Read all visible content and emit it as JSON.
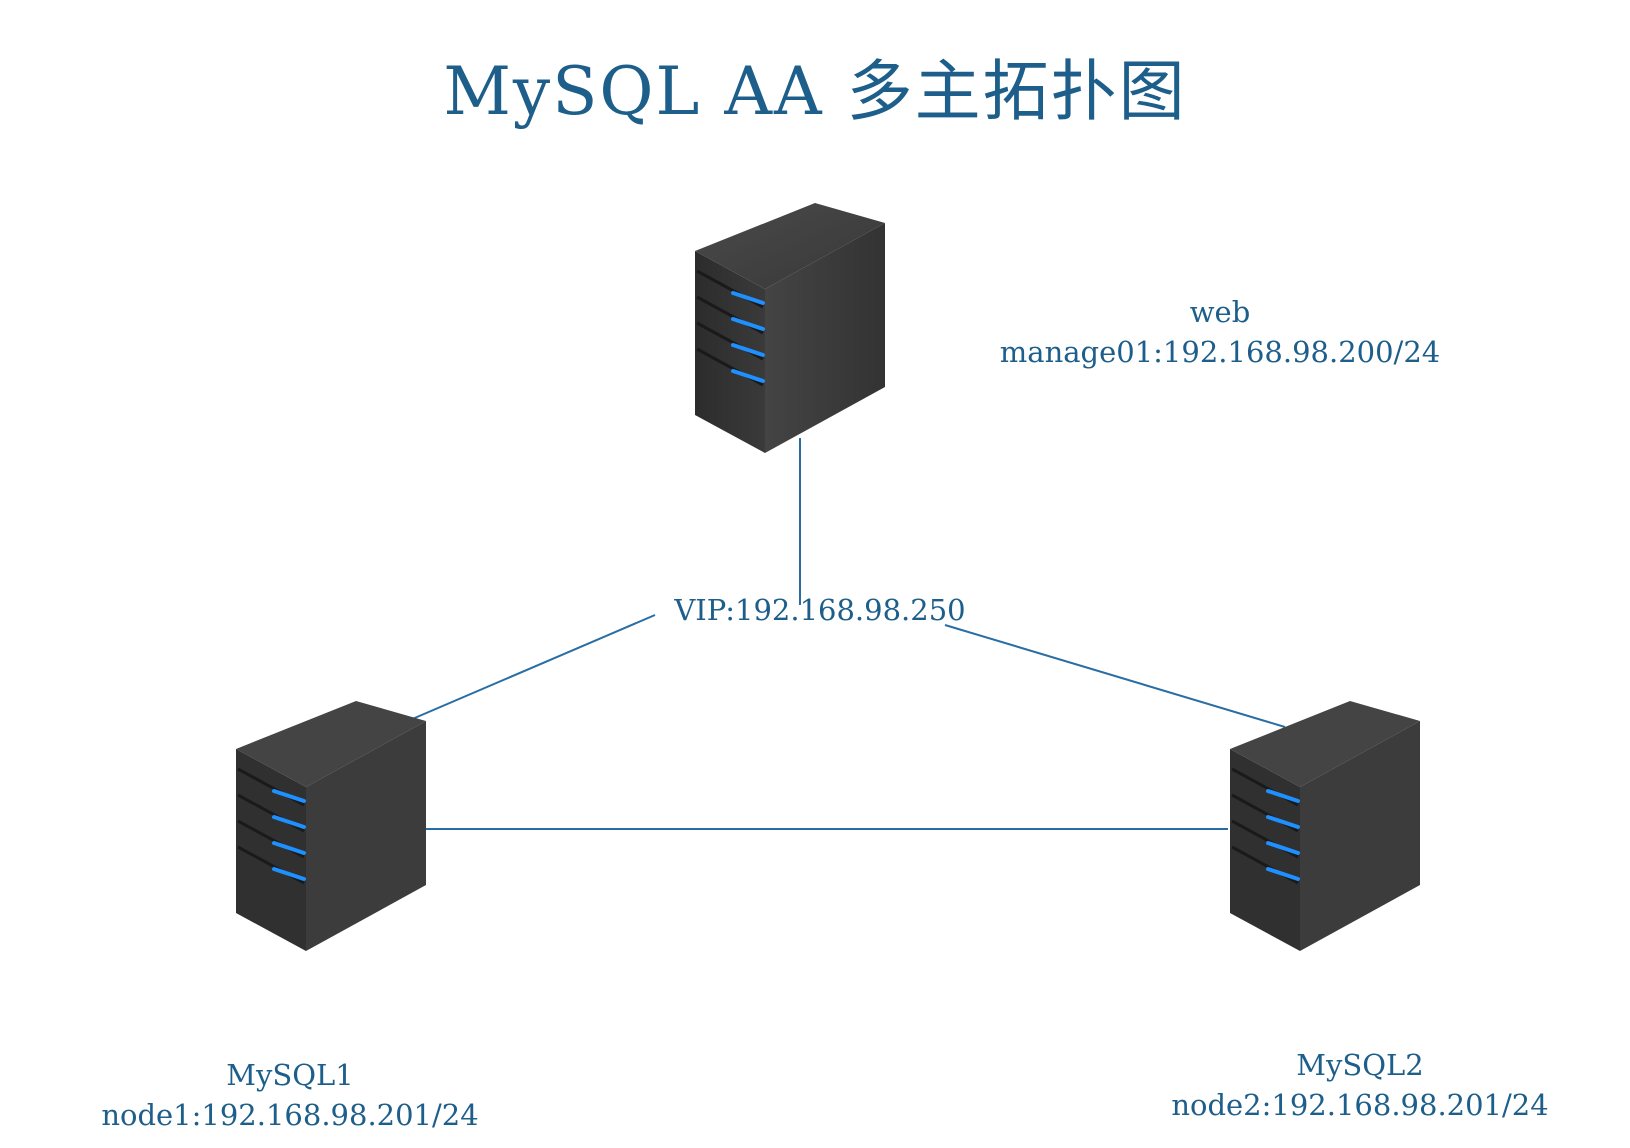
{
  "title": "MySQL AA 多主拓扑图",
  "vip_label": "VIP:192.168.98.250",
  "nodes": {
    "web": {
      "name": "web",
      "address": "manage01:192.168.98.200/24",
      "icon": "server-icon"
    },
    "mysql1": {
      "name": "MySQL1",
      "address": "node1:192.168.98.201/24",
      "icon": "server-icon"
    },
    "mysql2": {
      "name": "MySQL2",
      "address": "node2:192.168.98.201/24",
      "icon": "server-icon"
    }
  },
  "colors": {
    "text": "#1d5f8a",
    "link": "#2a6da3",
    "server_body": "#3a3a3a",
    "server_led": "#1e90ff"
  }
}
